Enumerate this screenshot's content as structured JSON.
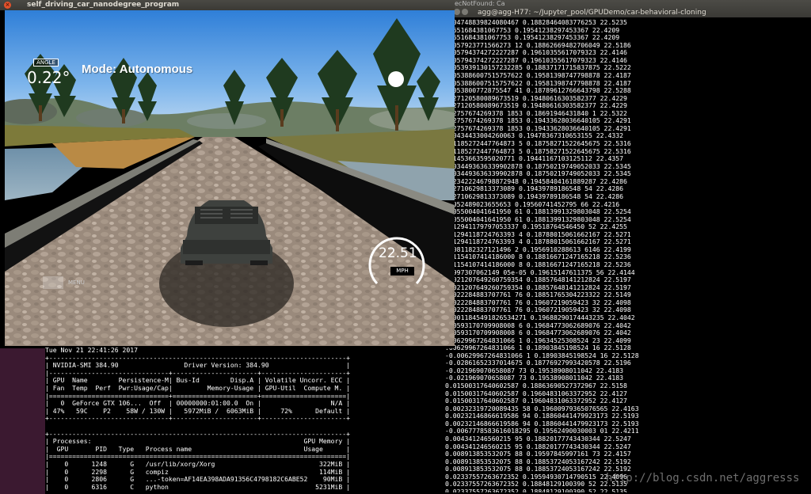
{
  "simulator": {
    "window_title": "self_driving_car_nanodegree_program",
    "hud": {
      "angle_label": "ANGLE",
      "angle_value": "0.22°",
      "mode": "Mode: Autonomous",
      "speed": "22.51",
      "speed_unit": "MPH",
      "menu_button": "",
      "menu_label": "MENU"
    }
  },
  "right_terminal": {
    "tab_title": "ecNotFound: Ca",
    "window_title": "agg@agg-H77: ~/Jupyter_pool/GPUDemo/car-behavioral-cloning",
    "log_lines": [
      ".004748839824080467 0.18828464083776253 22.5235",
      "01651684381067753 0.19541238297453367 22.4209",
      "01651684381067753 0.19541238297453367 22.4209",
      ".0057923771566273 12 0.18862669482706049 22.5186",
      ".005794374272227287 0.19610355617079323 22.4146",
      ".005794374272227287 0.19610355617079323 22.4146",
      ".0053939130157232285 0.18837171715837875 22.5222",
      ".0053886007515757622 0.19581398747798878 22.4187",
      ".0053886007515757622 0.19581398747798878 22.4187",
      ".0053800772875547 41 0.18789612766643798 22.5288",
      ".027120580089673519 0.19480616303582377 22.4229",
      ".027120580089673519 0.19480616303582377 22.4229",
      ".02757674269378 1853 0.18691946431840 1 22.5322",
      ".02757674269378 1853 0.19433628036640105 22.4291",
      ".02757674269378 1853 0.19433628036640105 22.4291",
      ".00434433004260063 0.19478367310653155 22.4332",
      ".01185272447764873 5 0.18758271522645675 22.5316",
      ".01185272447764873 5 0.18758271522645675 22.5316",
      ".01453663595020771 0.19441167103125112 22.4357",
      ".0034493636339902878 0.18750219749052033 22.5345",
      ".0034493636339902878 0.18750219749052033 22.5345",
      ".023422246798872948 0.19458404161889287 22.4286",
      ".02710629813373089 0.19439789186548 54 22.4286",
      ".02710629813373089 0.19439789186548 54 22.4286",
      ".0052489023655653 0.19560741452795 66 22.4216",
      ".0055004041641950 61 0.18813991329803048 22.5254",
      ".0055004041641950 61 0.18813991329803048 22.5254",
      ".012941179797053337 0.19518764546450 52 22.4255",
      ".01294118724763393 4 0.18788015061662167 22.5271",
      ".01294118724763393 4 0.18788015061662167 22.5271",
      ".0081182327121496 2 0.1956910288613 6146 22.4199",
      ".01154107414186000 8 0.18816671247165218 22.5236",
      ".01154107414186000 8 0.18816671247165218 22.5236",
      "04997307062149 05e-05 0.19615147611375 56 22.4144",
      ".0021207649260759354 0.18857648141212824 22.5197",
      ".0021207649260759354 0.18857648141212824 22.5197",
      ".0022284883707761 76 0.18851765304223322 22.5149",
      ".0022284883707761 76 0.19607219059423 32 22.4098",
      ".0022284883707761 76 0.19607219059423 32 22.4098",
      ".00011845491826534271 0.19688290174443235 22.4042",
      ".00593170709908008 6 0.19684773062689076 22.4042",
      ".00593170709908008 6 0.19684773062689076 22.4042",
      ".00629967264831066 1 0.19634525308524 23 22.4099",
      ".00629967264831066 1 0.18903845198524 16 22.5128",
      "-0.00629967264831066 1 0.18903845198524 16 22.5128",
      "-0.02861652337014675 0.18776927993420578 22.5196",
      "-0.021969070658087 73 0.19538908011042 22.4183",
      "-0.021969070658087 73 0.19538908011042 22.4183",
      "0.01500317640602587 0.18863690527372967 22.5158",
      "0.01500317640602587 0.19604831063372952 22.4127",
      "0.01500317640602587 0.19604831063372952 22.4127",
      "0.00232319720089435 58 0.19600979365076565 22.4163",
      "0.00232146866619586 94 0.18860441479923173 22.5193",
      "0.00232146866619586 94 0.18860441479923173 22.5193",
      "-0.0067778583616018295 0.19562490030003 01 22.4211",
      "0.004341246560215 95 0.18820177743430344 22.5247",
      "0.004341246560215 95 0.18820177743430344 22.5247",
      "0.008913853532075 88 0.19597845997161 73 22.4157",
      "0.008913853532075 88 0.18853724053167242 22.5192",
      "0.008913853532075 88 0.18853724053167242 22.5192",
      "0.02337557263672352 0.19594930714790515 22.4096",
      "0.02337557263672352 0.18848129100390 52 22.5135",
      "0.02337557263672352 0.18848129100390 52 22.5135"
    ],
    "watermark": "http://blog.csdn.net/aggresss"
  },
  "smi_terminal": {
    "lines": [
      "Tue Nov 21 22:41:26 2017",
      "+-----------------------------------------------------------------------------+",
      "| NVIDIA-SMI 384.90                 Driver Version: 384.90                    |",
      "|-------------------------------+----------------------+----------------------+",
      "| GPU  Name        Persistence-M| Bus-Id        Disp.A | Volatile Uncorr. ECC |",
      "| Fan  Temp  Perf  Pwr:Usage/Cap|         Memory-Usage | GPU-Util  Compute M. |",
      "|===============================+======================+======================|",
      "|   0  GeForce GTX 106...  Off  | 00000000:01:00.0  On |                  N/A |",
      "| 47%   59C    P2    58W / 130W |   5972MiB /  6063MiB |     72%      Default |",
      "+-------------------------------+----------------------+----------------------+",
      "",
      "+-----------------------------------------------------------------------------+",
      "| Processes:                                                       GPU Memory |",
      "|  GPU       PID   Type   Process name                             Usage      |",
      "|=============================================================================|",
      "|    0      1248      G   /usr/lib/xorg/Xorg                           322MiB |",
      "|    0      2298      G   compiz                                       114MiB |",
      "|    0      2806      G   ...-token=AF14EA398ADA91356C4798182C6ABE52    90MiB |",
      "|    0      6316      C   python                                      5231MiB |"
    ]
  },
  "colors": {
    "desktop": "#4a1f3a",
    "terminal_bg": "#000000",
    "terminal_fg": "#ffffff",
    "close_button": "#e2512b"
  }
}
